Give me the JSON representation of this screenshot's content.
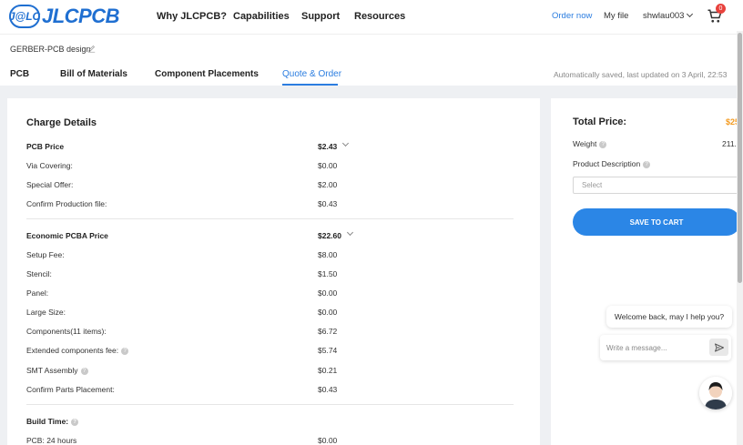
{
  "header": {
    "logo_badge": "J@LC",
    "logo_text": "JLCPCB",
    "nav": [
      "Why JLCPCB?",
      "Capabilities",
      "Support",
      "Resources"
    ],
    "order_now": "Order now",
    "my_file": "My file",
    "username": "shwlau003",
    "cart_count": "0"
  },
  "design": {
    "name": "GERBER-PCB design"
  },
  "tabs": [
    "PCB",
    "Bill of Materials",
    "Component Placements",
    "Quote & Order"
  ],
  "active_tab": "Quote & Order",
  "autosave_text": "Automatically saved, last updated on 3 April, 22:53",
  "charge": {
    "title": "Charge Details",
    "pcb_price_label": "PCB Price",
    "pcb_price_value": "$2.43",
    "via_label": "Via Covering:",
    "via_value": "$0.00",
    "special_label": "Special Offer:",
    "special_value": "$2.00",
    "confirm_file_label": "Confirm Production file:",
    "confirm_file_value": "$0.43",
    "pcba_label": "Economic PCBA Price",
    "pcba_value": "$22.60",
    "setup_label": "Setup Fee:",
    "setup_value": "$8.00",
    "stencil_label": "Stencil:",
    "stencil_value": "$1.50",
    "panel_label": "Panel:",
    "panel_value": "$0.00",
    "large_label": "Large Size:",
    "large_value": "$0.00",
    "components_label": "Components(11 items):",
    "components_value": "$6.72",
    "extended_label": "Extended components fee:",
    "extended_value": "$5.74",
    "smt_label": "SMT Assembly",
    "smt_value": "$0.21",
    "confirm_parts_label": "Confirm Parts Placement:",
    "confirm_parts_value": "$0.43",
    "build_time_label": "Build Time:",
    "pcb_time_label": "PCB:  24 hours",
    "pcb_time_value": "$0.00"
  },
  "summary": {
    "total_label": "Total Price:",
    "total_value": "$25",
    "weight_label": "Weight",
    "weight_value": "211.",
    "desc_label": "Product Description",
    "select_placeholder": "Select",
    "save_button": "SAVE TO CART"
  },
  "chat": {
    "welcome": "Welcome back, may I help you?",
    "placeholder": "Write a message..."
  },
  "colors": {
    "accent": "#2b7de0",
    "price_orange": "#f39a1f",
    "badge_red": "#e8423d"
  }
}
